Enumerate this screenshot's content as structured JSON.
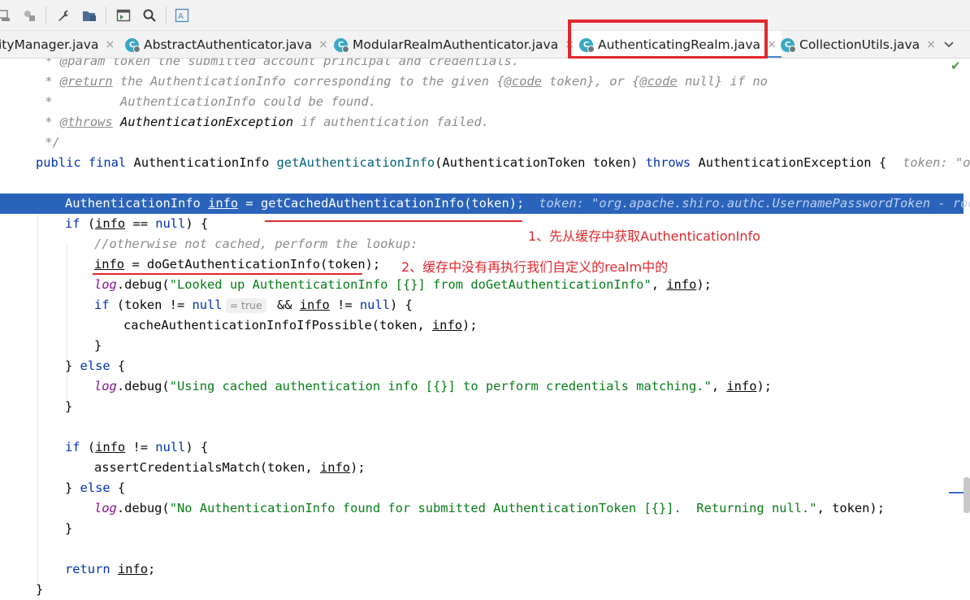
{
  "toolbar": {
    "buttons": [
      {
        "name": "run-config-icon"
      },
      {
        "name": "build-icon"
      },
      {
        "name": "wrench-icon"
      },
      {
        "name": "project-structure-icon"
      },
      {
        "name": "terminal-icon"
      },
      {
        "name": "search-icon"
      },
      {
        "name": "translate-icon"
      }
    ]
  },
  "tabs": [
    {
      "label": "ityManager.java",
      "active": false,
      "has_icon": false
    },
    {
      "label": "AbstractAuthenticator.java",
      "active": false,
      "has_icon": true
    },
    {
      "label": "ModularRealmAuthenticator.java",
      "active": false,
      "has_icon": true
    },
    {
      "label": "AuthenticatingRealm.java",
      "active": true,
      "has_icon": true
    },
    {
      "label": "CollectionUtils.java",
      "active": false,
      "has_icon": true
    }
  ],
  "tab_close_glyph": "×",
  "tab_icon_letter": "C",
  "highlight_color": "#e0282e",
  "code": {
    "l1": " * @param token the submitted account principal and credentials.",
    "l2a": " * ",
    "l2b": "@return",
    "l2c": " the AuthenticationInfo corresponding to the given {",
    "l2d": "@code",
    "l2e": " token}, or {",
    "l2f": "@code",
    "l2g": " null} if no",
    "l3": " *         AuthenticationInfo could be found.",
    "l4a": " * ",
    "l4b": "@throws",
    "l4c": " AuthenticationException",
    "l4d": " if authentication failed.",
    "l5": " */",
    "l6a": "public final",
    "l6b": " AuthenticationInfo ",
    "l6c": "getAuthenticationInfo",
    "l6d": "(AuthenticationToken token) ",
    "l6e": "throws",
    "l6f": " AuthenticationException {",
    "l6hint": "token: \"org.",
    "l8a": "AuthenticationInfo ",
    "l8b": "info",
    "l8c": " = getCachedAuthenticationInfo(token);",
    "l8hint": "token: \"org.apache.shiro.authc.UsernamePasswordToken - root,",
    "l9a": "if",
    "l9b": " (",
    "l9c": "info",
    "l9d": " == ",
    "l9e": "null",
    "l9f": ") {",
    "l10": "//otherwise not cached, perform the lookup:",
    "l11a": "info",
    "l11b": " = doGetAuthenticationInfo(token);",
    "l12a": "log",
    "l12b": ".debug(",
    "l12c": "\"Looked up AuthenticationInfo [{}] from doGetAuthenticationInfo\"",
    "l12d": ", ",
    "l12e": "info",
    "l12f": ");",
    "l13a": "if",
    "l13b": " (token != ",
    "l13c": "null",
    "l13hint": "= true",
    "l13d": " && ",
    "l13e": "info",
    "l13f": " != ",
    "l13g": "null",
    "l13h": ") {",
    "l14a": "cacheAuthenticationInfoIfPossible(token, ",
    "l14b": "info",
    "l14c": ");",
    "l15": "}",
    "l16a": "} ",
    "l16b": "else",
    "l16c": " {",
    "l17a": "log",
    "l17b": ".debug(",
    "l17c": "\"Using cached authentication info [{}] to perform credentials matching.\"",
    "l17d": ", ",
    "l17e": "info",
    "l17f": ");",
    "l18": "}",
    "l20a": "if",
    "l20b": " (",
    "l20c": "info",
    "l20d": " != ",
    "l20e": "null",
    "l20f": ") {",
    "l21a": "assertCredentialsMatch(token, ",
    "l21b": "info",
    "l21c": ");",
    "l22a": "} ",
    "l22b": "else",
    "l22c": " {",
    "l23a": "log",
    "l23b": ".debug(",
    "l23c": "\"No AuthenticationInfo found for submitted AuthenticationToken [{}].  Returning null.\"",
    "l23d": ", token);",
    "l24": "}",
    "l26a": "return",
    "l26b": " ",
    "l26c": "info",
    "l26d": ";",
    "l27": "}"
  },
  "annotations": {
    "a1": "1、先从缓存中获取AuthenticationInfo",
    "a2": "2、缓存中没有再执行我们自定义的realm中的"
  }
}
